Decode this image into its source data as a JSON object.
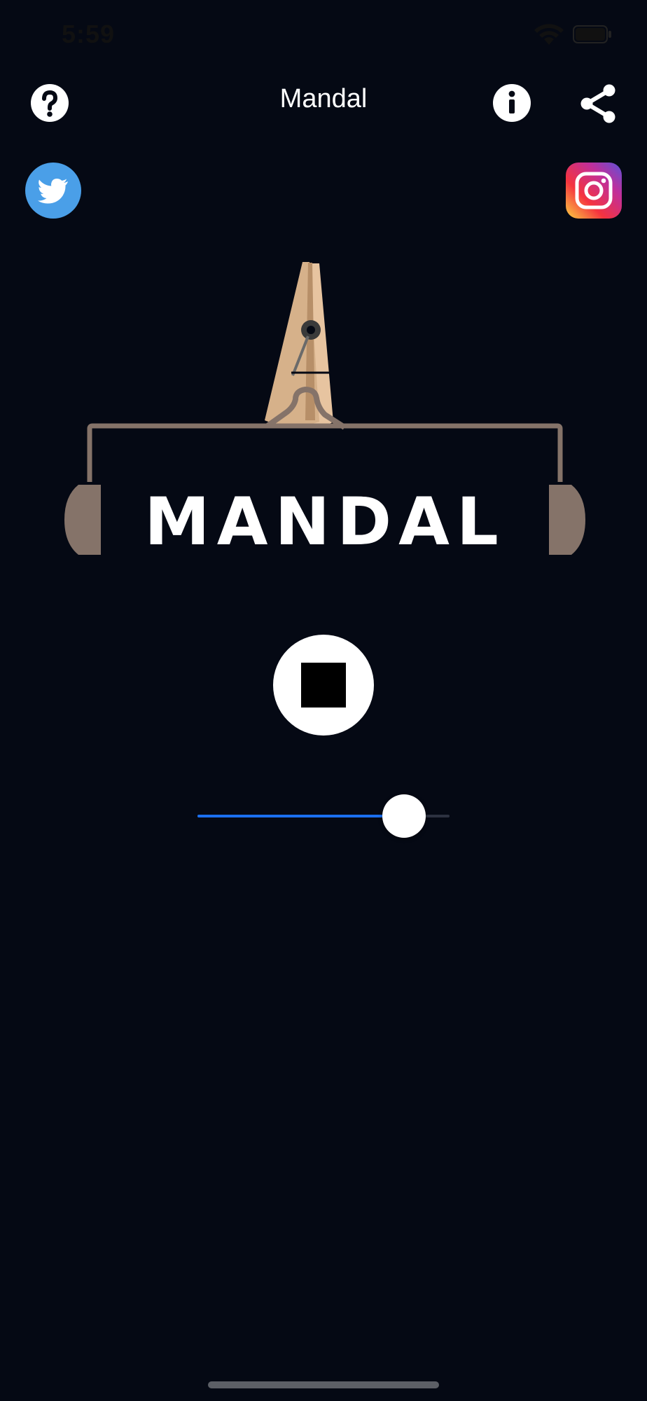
{
  "status_bar": {
    "time": "5:59",
    "wifi_icon": "wifi-icon",
    "battery_icon": "battery-icon"
  },
  "nav": {
    "title": "Mandal",
    "help_icon": "question-mark-icon",
    "info_icon": "info-icon",
    "share_icon": "share-icon"
  },
  "social": {
    "twitter_icon": "twitter-bird-icon",
    "twitter_color": "#4a9fe8",
    "instagram_icon": "instagram-camera-icon",
    "instagram_colors": [
      "#fbd041",
      "#f5333f",
      "#c02f9b",
      "#5b52d8"
    ]
  },
  "logo": {
    "text": "MANDAL",
    "clothespin_color": "#e7c4a0",
    "headphone_color": "#857369"
  },
  "player": {
    "state": "playing",
    "control_icon": "stop-icon",
    "volume": 0.82,
    "accent_color": "#1b6ff0"
  },
  "colors": {
    "background": "#050914",
    "foreground": "#ffffff"
  }
}
